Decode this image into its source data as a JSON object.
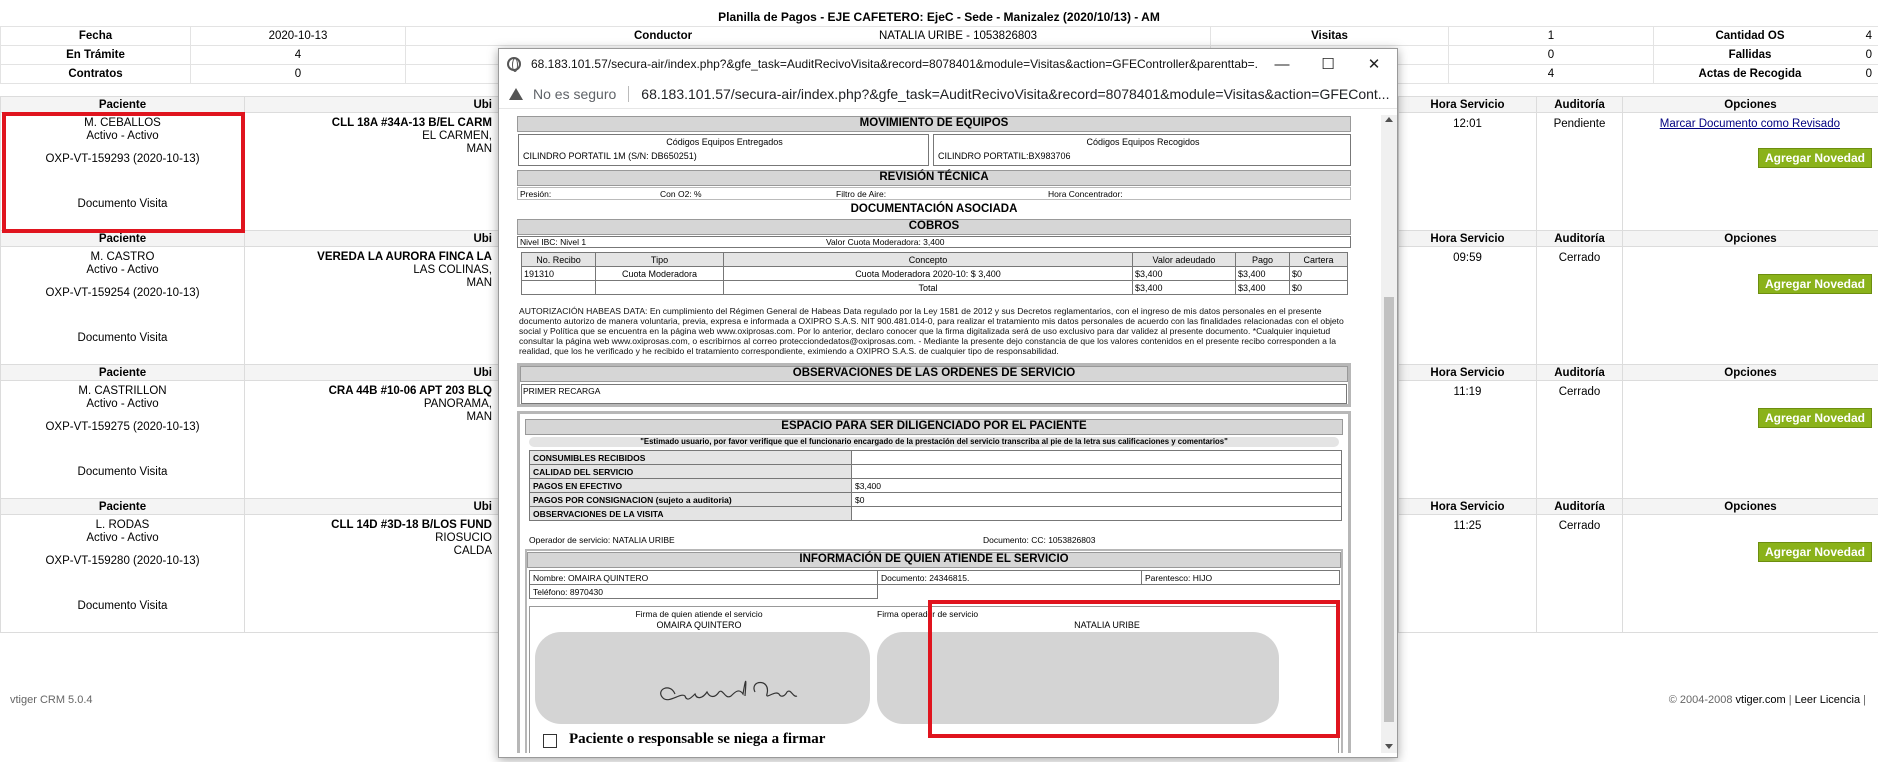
{
  "summary": {
    "title": "Planilla de Pagos - EJE CAFETERO: EjeC - Sede - Manizalez (2020/10/13) - AM",
    "rows": [
      [
        {
          "label": "Fecha",
          "value": "2020-10-13"
        },
        {
          "label": "Conductor",
          "value": "NATALIA URIBE - 1053826803"
        },
        {
          "label": "Visitas",
          "value": "1"
        },
        {
          "label": "Cantidad OS",
          "value": "4"
        }
      ],
      [
        {
          "label": "En Trámite",
          "value": "4"
        },
        {
          "label": "",
          "value": ""
        },
        {
          "label": "",
          "value": "0"
        },
        {
          "label": "Fallidas",
          "value": "0"
        }
      ],
      [
        {
          "label": "Contratos",
          "value": "0"
        },
        {
          "label": "",
          "value": ""
        },
        {
          "label": "",
          "value": "4"
        },
        {
          "label": "Actas de Recogida",
          "value": "0"
        }
      ]
    ]
  },
  "records_header": {
    "paciente": "Paciente",
    "ubicacion": "Ubi",
    "hora": "Hora Servicio",
    "auditoria": "Auditoría",
    "opciones": "Opciones"
  },
  "records": [
    {
      "name": "M. CEBALLOS",
      "status": "Activo - Activo",
      "code": "OXP-VT-159293 (2020-10-13)",
      "doc": "Documento Visita",
      "addr1": "CLL 18A #34A-13 B/EL CARM",
      "addr2": "EL CARMEN,",
      "addr3": "MAN",
      "hora": "12:01",
      "auditoria": "Pendiente",
      "marcar": "Marcar Documento como Revisado",
      "novedad": "Agregar Novedad"
    },
    {
      "name": "M. CASTRO",
      "status": "Activo - Activo",
      "code": "OXP-VT-159254 (2020-10-13)",
      "doc": "Documento Visita",
      "addr1": "VEREDA LA AURORA FINCA LA",
      "addr2": "LAS COLINAS,",
      "addr3": "MAN",
      "hora": "09:59",
      "auditoria": "Cerrado",
      "marcar": "",
      "novedad": "Agregar Novedad"
    },
    {
      "name": "M. CASTRILLON",
      "status": "Activo - Activo",
      "code": "OXP-VT-159275 (2020-10-13)",
      "doc": "Documento Visita",
      "addr1": "CRA 44B #10-06 APT 203 BLQ",
      "addr2": "PANORAMA,",
      "addr3": "MAN",
      "hora": "11:19",
      "auditoria": "Cerrado",
      "marcar": "",
      "novedad": "Agregar Novedad"
    },
    {
      "name": "L. RODAS",
      "status": "Activo - Activo",
      "code": "OXP-VT-159280 (2020-10-13)",
      "doc": "Documento Visita",
      "addr1": "CLL 14D #3D-18 B/LOS FUND",
      "addr2": "RIOSUCIO",
      "addr3": "CALDA",
      "hora": "11:25",
      "auditoria": "Cerrado",
      "marcar": "",
      "novedad": "Agregar Novedad"
    }
  ],
  "footer": {
    "left": "vtiger CRM 5.0.4",
    "copyright": "© 2004-2008 ",
    "vtiger_link": "vtiger.com",
    "sep": " | ",
    "license_link": "Leer Licencia",
    "trail": " |"
  },
  "popup": {
    "title": "68.183.101.57/secura-air/index.php?&gfe_task=AuditRecivoVisita&record=8078401&module=Visitas&action=GFEController&parenttab=...",
    "insecure": "No es seguro",
    "url": "68.183.101.57/secura-air/index.php?&gfe_task=AuditRecivoVisita&record=8078401&module=Visitas&action=GFECont...",
    "minimize": "—",
    "maximize": "☐",
    "close": "✕",
    "doc": {
      "movimiento": "MOVIMIENTO DE EQUIPOS",
      "entregados_h": "Códigos Equipos Entregados",
      "entregados_v": "CILINDRO PORTATIL 1M (S/N: DB650251)",
      "recogidos_h": "Códigos Equipos Recogidos",
      "recogidos_v": "CILINDRO PORTATIL:BX983706",
      "revision": "REVISIÓN TÉCNICA",
      "presion": "Presión:",
      "con_o2": "Con O2: %",
      "filtro": "Filtro de Aire:",
      "hora_conc": "Hora Concentrador:",
      "documentacion": "DOCUMENTACIÓN ASOCIADA",
      "cobros": "COBROS",
      "nivel": "Nivel IBC: Nivel 1",
      "valor_cuota": "Valor Cuota Moderadora: 3,400",
      "cobros_head": [
        "No. Recibo",
        "Tipo",
        "Concepto",
        "Valor adeudado",
        "Pago",
        "Cartera"
      ],
      "cobros_row": [
        "191310",
        "Cuota Moderadora",
        "Cuota Moderadora 2020-10: $ 3,400",
        "$3,400",
        "$3,400",
        "$0"
      ],
      "cobros_total": [
        "Total",
        "$3,400",
        "$3,400",
        "$0"
      ],
      "legal": "AUTORIZACIÓN HABEAS DATA: En cumplimiento del Régimen General de Habeas Data regulado por la Ley 1581 de 2012 y sus Decretos reglamentarios, con el ingreso de mis datos personales en el presente documento autorizo de manera voluntaria, previa, expresa e informada a OXIPRO S.A.S. NIT 900.481.014-0, para realizar el tratamiento mis datos personales de acuerdo con las finalidades relacionadas con el objeto social y Política que se encuentra en la página web www.oxiprosas.com. Por lo anterior, declaro conocer que la firma digitalizada será de uso exclusivo para dar validez al presente documento. *Cualquier inquietud consultar la página web www.oxiprosas.com, o escribirnos al correo protecciondedatos@oxiprosas.com. - Mediante la presente dejo constancia de que los valores contenidos en el presente recibo corresponden a la realidad, que los he verificado y he recibido el tratamiento correspondiente, eximiendo a OXIPRO S.A.S. de cualquier tipo de responsabilidad.",
      "observaciones": "OBSERVACIONES DE LAS ORDENES DE SERVICIO",
      "observ_val": "PRIMER RECARGA",
      "espacio": "ESPACIO PARA SER DILIGENCIADO POR EL PACIENTE",
      "estimado": "\"Estimado usuario, por favor verifique que el funcionario encargado de la prestación del servicio transcriba al pie de la letra sus calificaciones y comentarios\"",
      "pac_rows": [
        {
          "label": "CONSUMIBLES RECIBIDOS",
          "value": ""
        },
        {
          "label": "CALIDAD DEL SERVICIO",
          "value": ""
        },
        {
          "label": "PAGOS EN EFECTIVO",
          "value": "$3,400"
        },
        {
          "label": "PAGOS POR CONSIGNACION (sujeto a auditoria)",
          "value": "$0"
        },
        {
          "label": "OBSERVACIONES DE LA VISITA",
          "value": ""
        }
      ],
      "operador": "Operador de servicio: NATALIA URIBE",
      "documento_op": "Documento: CC: 1053826803",
      "info_quien": "INFORMACIÓN DE QUIEN ATIENDE EL SERVICIO",
      "nombre": "Nombre: OMAIRA QUINTERO",
      "documento": "Documento: 24346815.",
      "parentesco": "Parentesco: HIJO",
      "telefono": "Teléfono: 8970430",
      "firma_quien": "Firma de quien atiende el servicio",
      "firma_quien_nombre": "OMAIRA QUINTERO",
      "firma_op": "Firma operador de servicio",
      "firma_op_nombre": "NATALIA URIBE",
      "niega": "Paciente o responsable se niega a firmar"
    }
  },
  "colors": {
    "highlight": "#e0141e",
    "novedad_button": "#8ab21a",
    "section_header": "#d6d6d6"
  }
}
